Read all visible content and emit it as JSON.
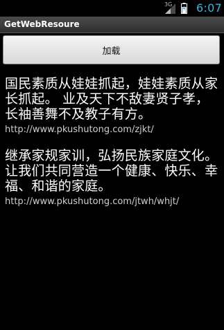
{
  "status_bar": {
    "network_label": "3G",
    "time": "6:07",
    "time_color": "#33b5e5"
  },
  "title_bar": {
    "title": "GetWebResoure"
  },
  "toolbar": {
    "load_label": "加载"
  },
  "articles": [
    {
      "text": "国民素质从娃娃抓起，娃娃素质从家长抓起。 业及天下不敌妻贤子孝，长袖善舞不及教子有方。",
      "url": "http://www.pkushutong.com/zjkt/"
    },
    {
      "text": "继承家规家训，弘扬民族家庭文化。 让我们共同营造一个健康、快乐、幸福、和谐的家庭。",
      "url": "http://www.pkushutong.com/jtwh/whjt/"
    }
  ]
}
